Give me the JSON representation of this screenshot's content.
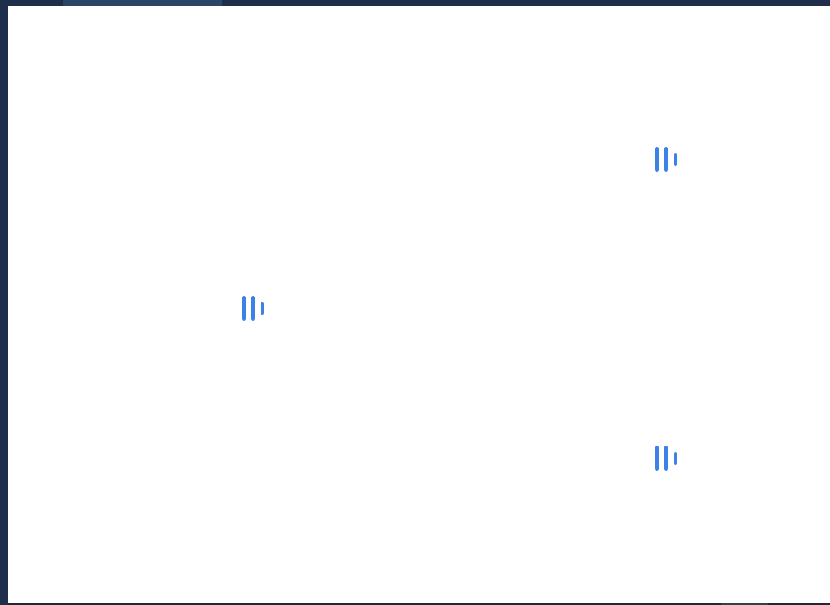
{
  "colors": {
    "window_chrome": "#1f2e4a",
    "active_tab": "#2a4566",
    "panel_background": "#ffffff",
    "loader_accent": "#3b82e6",
    "bottom_bar": "#222831"
  },
  "loaders": [
    {
      "icon": "loading-bars-icon"
    },
    {
      "icon": "loading-bars-icon"
    },
    {
      "icon": "loading-bars-icon"
    }
  ]
}
